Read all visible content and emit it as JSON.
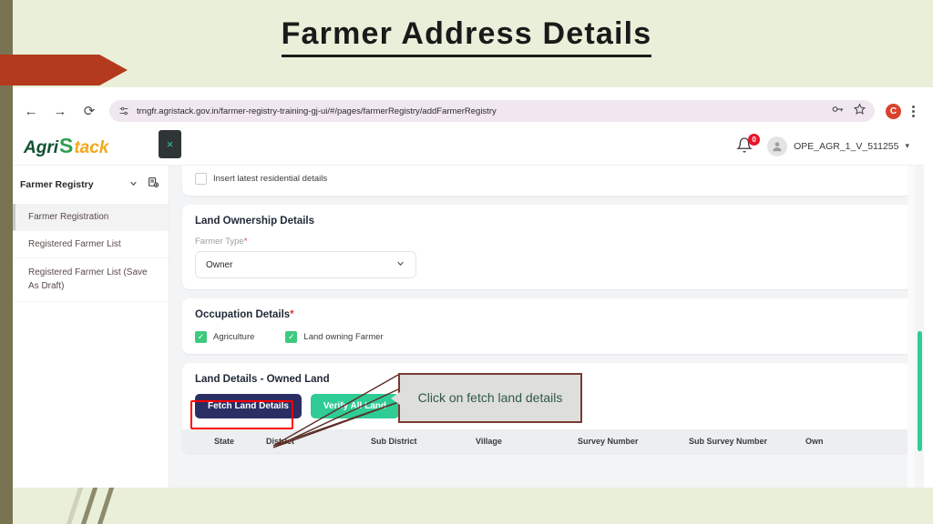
{
  "slide": {
    "title": "Farmer Address Details"
  },
  "browser": {
    "back_icon": "back-arrow-icon",
    "forward_icon": "forward-arrow-icon",
    "reload_icon": "reload-icon",
    "url": "trngfr.agristack.gov.in/farmer-registry-training-gj-ui/#/pages/farmerRegistry/addFarmerRegistry",
    "site_settings_icon": "tune-icon",
    "password_icon": "key-icon",
    "bookmark_icon": "star-icon",
    "profile_initial": "C",
    "menu_icon": "kebab-menu-icon"
  },
  "app_header": {
    "logo": {
      "part1": "Agri",
      "part2": "S",
      "part3": "tack"
    },
    "notification_badge": "0",
    "username": "OPE_AGR_1_V_511255",
    "caret": "⌄"
  },
  "sidebar": {
    "close_label": "×",
    "section_title": "Farmer Registry",
    "items": [
      {
        "label": "Farmer Registration",
        "active": true
      },
      {
        "label": "Registered Farmer List",
        "active": false
      },
      {
        "label": "Registered Farmer List (Save As Draft)",
        "active": false
      }
    ]
  },
  "form": {
    "residential": {
      "checkbox_label": "Insert latest residential details",
      "checked": false
    },
    "land_ownership": {
      "title": "Land Ownership Details",
      "farmer_type_label": "Farmer Type",
      "farmer_type_required": "*",
      "farmer_type_value": "Owner"
    },
    "occupation": {
      "title": "Occupation Details",
      "required": "*",
      "options": [
        {
          "label": "Agriculture",
          "checked": true
        },
        {
          "label": "Land owning Farmer",
          "checked": true
        }
      ]
    },
    "land_details": {
      "title": "Land Details - Owned Land",
      "fetch_button": "Fetch Land Details",
      "verify_button": "Verify All Land",
      "table_headers": [
        "State",
        "District",
        "Sub District",
        "Village",
        "Survey Number",
        "Sub Survey Number",
        "Own"
      ]
    }
  },
  "annotation": {
    "callout_text": "Click on fetch land details"
  },
  "colors": {
    "navy_button": "#2b2e63",
    "green_button": "#2fcc96",
    "highlight": "#ff0000",
    "callout_border": "#7b3a32",
    "callout_text": "#2f5a46",
    "arrow_banner": "#b33a1c",
    "slide_background": "#e9efd9",
    "checkbox_green": "#3ec97f"
  }
}
